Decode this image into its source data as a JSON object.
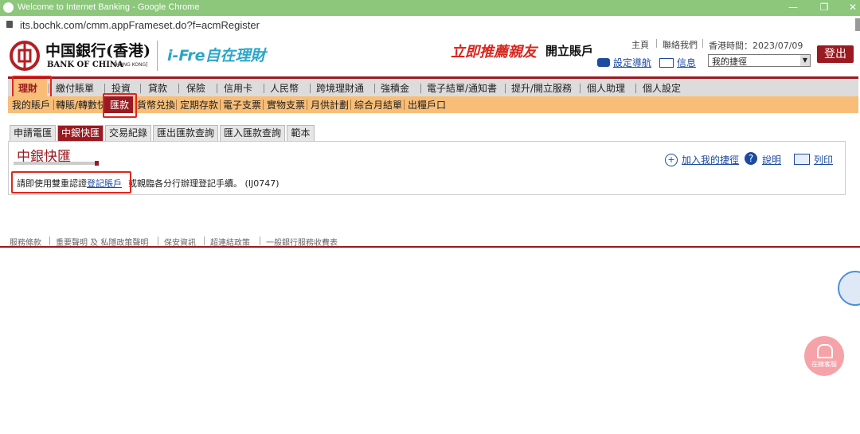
{
  "browser": {
    "title": "Welcome to Internet Banking - Google Chrome",
    "url": "its.bochk.com/cmm.appFrameset.do?f=acmRegister"
  },
  "header": {
    "logo_cn": "中国銀行(香港)",
    "logo_en": "BANK OF CHINA",
    "logo_en_sub": "[HONG KONG]",
    "brand": "i-Fre自在理財",
    "promo": "立即推薦親友",
    "promo_sub": "開立賬戶",
    "top_links": {
      "home": "主頁",
      "contact": "聯絡我們"
    },
    "time_label": "香港時間：2023/07/09",
    "setup_guide": "設定導航",
    "messages": "信息",
    "shortcut_selected": "我的捷徑",
    "logout": "登出"
  },
  "main_nav": [
    "理財",
    "繳付賬單",
    "投資",
    "貸款",
    "保險",
    "信用卡",
    "人民幣",
    "跨境理財通",
    "強積金",
    "電子結單/通知書",
    "提升/開立服務",
    "個人助理",
    "個人設定"
  ],
  "sub_nav": [
    "我的賬戶",
    "轉賬/轉數快",
    "匯款",
    "貨幣兑換",
    "定期存款",
    "電子支票",
    "實物支票",
    "月供計劃",
    "綜合月結單",
    "出糧戶口"
  ],
  "tabs": [
    "申請電匯",
    "中銀快匯",
    "交易紀錄",
    "匯出匯款查詢",
    "匯入匯款查詢",
    "範本"
  ],
  "content": {
    "heading": "中銀快匯",
    "add_shortcut": "加入我的捷徑",
    "help": "說明",
    "print": "列印",
    "message_prefix": "請即使用雙重認證",
    "message_link": "登記賬戶",
    "message_suffix": "或親臨各分行辦理登記手續。 (IJ0747)"
  },
  "footer": [
    "服務條款",
    "重要聲明 及 私隱政策聲明",
    "保安資訊",
    "超連結政策",
    "一般銀行服務收費表"
  ],
  "chat_label": "在線客服",
  "colors": {
    "brand_red": "#9a1a21",
    "subnav_orange": "#f8be78",
    "chrome_green": "#8cc77c",
    "highlight_red": "#e1261c"
  }
}
